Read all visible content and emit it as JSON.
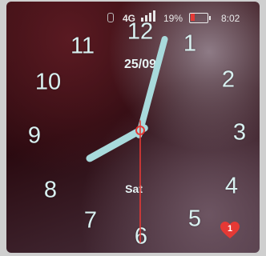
{
  "status_bar": {
    "network": "4G",
    "battery_percent": "19%",
    "time": "8:02"
  },
  "clock": {
    "numbers": [
      "12",
      "1",
      "2",
      "3",
      "4",
      "5",
      "6",
      "7",
      "8",
      "9",
      "10",
      "11"
    ],
    "date": "25/09",
    "day": "Sat",
    "hour": 8,
    "minute": 2,
    "second": 30
  },
  "heart_badge": {
    "count": "1"
  },
  "colors": {
    "hands": "#a8dadc",
    "second_hand": "#e53935",
    "numerals": "#d8f0f0",
    "battery_low": "#e53935",
    "heart": "#e53935"
  }
}
